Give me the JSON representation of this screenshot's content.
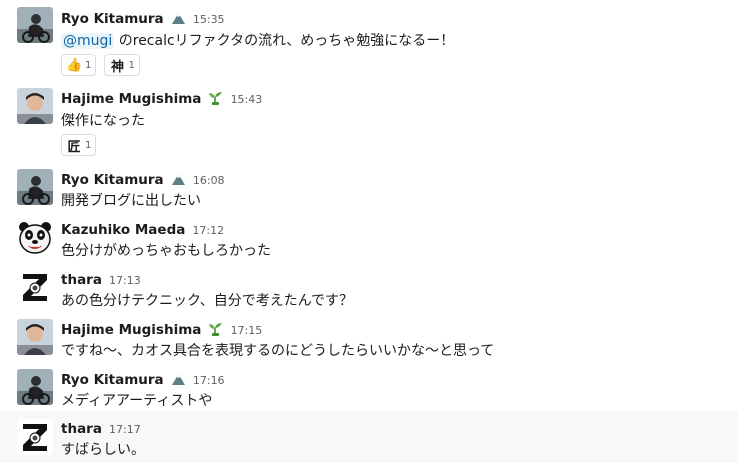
{
  "users": {
    "ryo": {
      "name": "Ryo Kitamura",
      "status_icon": "mountain-icon"
    },
    "hajime": {
      "name": "Hajime Mugishima",
      "status_icon": "sprout-icon"
    },
    "kazuhiko": {
      "name": "Kazuhiko Maeda"
    },
    "thara": {
      "name": "thara"
    }
  },
  "messages": [
    {
      "user": "Ryo Kitamura",
      "time": "15:35",
      "mention": "@mugi",
      "text": " のrecalcリファクタの流れ、めっちゃ勉強になるー！",
      "reactions": [
        {
          "emoji": "👍",
          "name": "thumbsup-emoji",
          "count": "1"
        },
        {
          "emoji": "神",
          "name": "kami-emoji",
          "count": "1"
        }
      ]
    },
    {
      "user": "Hajime Mugishima",
      "time": "15:43",
      "text": "傑作になった",
      "reactions": [
        {
          "emoji": "匠",
          "name": "takumi-emoji",
          "count": "1"
        }
      ]
    },
    {
      "user": "Ryo Kitamura",
      "time": "16:08",
      "text": "開発ブログに出したい"
    },
    {
      "user": "Kazuhiko Maeda",
      "time": "17:12",
      "text": "色分けがめっちゃおもしろかった"
    },
    {
      "user": "thara",
      "time": "17:13",
      "text": "あの色分けテクニック、自分で考えたんです？"
    },
    {
      "user": "Hajime Mugishima",
      "time": "17:15",
      "text": "ですね〜、カオス具合を表現するのにどうしたらいいかな〜と思って"
    },
    {
      "user": "Ryo Kitamura",
      "time": "17:16",
      "text": "メディアアーティストや"
    },
    {
      "user": "thara",
      "time": "17:17",
      "text": "すばらしい。"
    }
  ],
  "colors": {
    "name": "#1d1c1d",
    "timestamp": "#616061",
    "mention": "#1264a3",
    "mention_bg": "#e8f5fa",
    "hover_row_bg": "#f8f8f8",
    "reaction_border": "#dddddd"
  }
}
